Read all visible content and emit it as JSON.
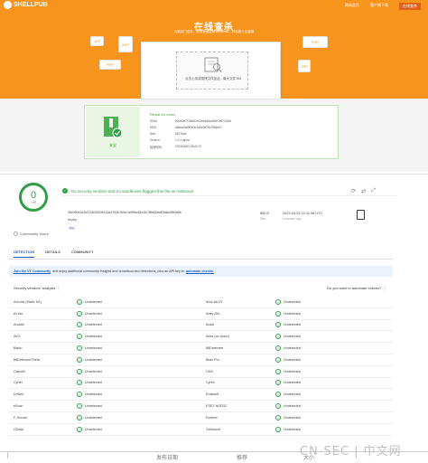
{
  "shellpub": {
    "logo_text": "SHELLPUB",
    "nav": [
      "网站首页",
      "客户端下载",
      "在线查杀"
    ],
    "hero_title": "在线查杀",
    "hero_subtitle": "云鉴后门查杀，支持全面检测WebShell，样本数十亿级别",
    "deco": [
      "JSP",
      "ASP",
      "PHP",
      "PHP",
      "JSP"
    ],
    "upload_text": "点击上传或拖拽文件至此，最大文件 5M",
    "result": {
      "title": "Result for xxxxx",
      "safe_label": "安全",
      "rows": [
        {
          "k": "SHA1",
          "v": "620e5e072f6b02c03be646ad49e7a97216f6"
        },
        {
          "k": "MD5",
          "v": "a5afac9a6e0e8c1a9e9a78c7966e07"
        },
        {
          "k": "Size",
          "v": "620 Byte"
        },
        {
          "k": "Version",
          "v": "1.0.1 alpha"
        },
        {
          "k": "检测时间",
          "v": "2023/06/03 09:00:27"
        }
      ]
    }
  },
  "vt": {
    "score": "0",
    "score_den": "/ 59",
    "community_label": "Community Score",
    "banner": "No security vendors and no sandboxes flagged this file as malicious",
    "hash": "08c99043d2b21263002f9142a2762b7b0b7a4f9bc44e1fc7f8e82adf03a8c58f3a8b",
    "filename": "ss.php",
    "tag": "php",
    "size_label": "Size",
    "size_value": "860 B",
    "date_value": "2023-04-03 12:41:08 UTC",
    "date_rel": "a moment ago",
    "tabs": [
      "DETECTION",
      "DETAILS",
      "COMMUNITY"
    ],
    "join_link": "Join the VT Community",
    "join_text": "and enjoy additional community insights and crowdsourced detections, plus an API key to",
    "join_link2": "automate checks.",
    "vendors_head": "Security vendors' analysis",
    "automate_prompt": "Do you want to automate checks?",
    "status": "Undetected",
    "vendors": [
      [
        "Acronis (Static ML)",
        "AhnLab-V3"
      ],
      [
        "ALYac",
        "Antiy-AVL"
      ],
      [
        "Arcabit",
        "Avast"
      ],
      [
        "AVG",
        "Avira (no cloud)"
      ],
      [
        "Baidu",
        "BitDefender"
      ],
      [
        "BitDefenderTheta",
        "Bkav Pro"
      ],
      [
        "ClamAV",
        "CMC"
      ],
      [
        "Cynet",
        "Cyren"
      ],
      [
        "DrWeb",
        "Emsisoft"
      ],
      [
        "eScan",
        "ESET-NOD32"
      ],
      [
        "F-Secure",
        "Fortinet"
      ],
      [
        "GData",
        "Gridinsoft"
      ]
    ]
  },
  "bottom_bar": [
    "发布日期",
    "推荐",
    "大小"
  ],
  "watermark": "CN-SEC | 中文网",
  "colors": {
    "orange": "#f7941d",
    "green": "#2e9e47",
    "blue": "#1b5dbf"
  }
}
